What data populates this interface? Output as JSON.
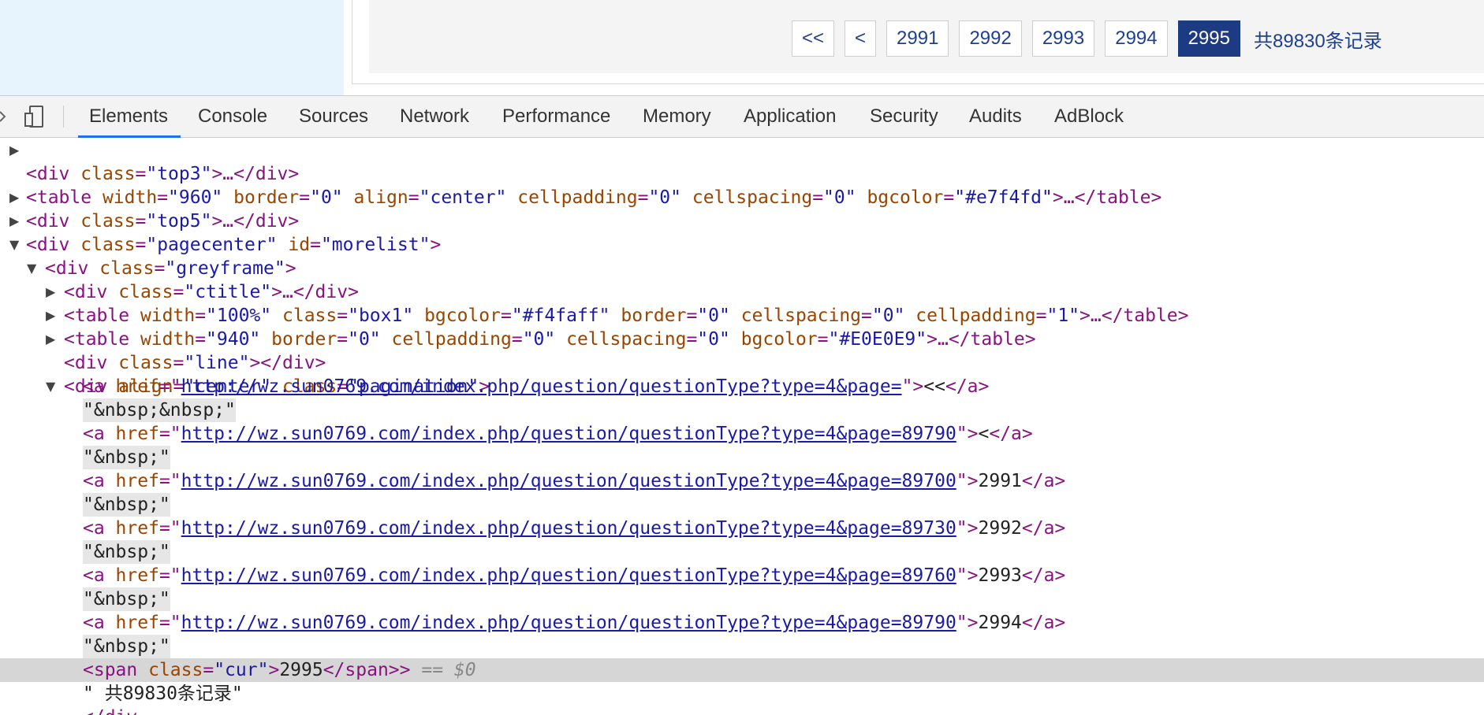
{
  "pagination": {
    "first": "<<",
    "prev": "<",
    "pages": [
      "2991",
      "2992",
      "2993",
      "2994"
    ],
    "current": "2995",
    "total_text": "共89830条记录"
  },
  "devtools": {
    "tabs": [
      "Elements",
      "Console",
      "Sources",
      "Network",
      "Performance",
      "Memory",
      "Application",
      "Security",
      "Audits",
      "AdBlock"
    ],
    "active_tab": "Elements",
    "dom": {
      "l1": {
        "open": "<div ",
        "a1": "class",
        "v1": "\"top3\"",
        "close": ">…</div>"
      },
      "l2": {
        "open": "<table ",
        "a1": "width",
        "v1": "\"960\"",
        "a2": "border",
        "v2": "\"0\"",
        "a3": "align",
        "v3": "\"center\"",
        "a4": "cellpadding",
        "v4": "\"0\"",
        "a5": "cellspacing",
        "v5": "\"0\"",
        "a6": "bgcolor",
        "v6": "\"#e7f4fd\"",
        "close": ">…</table>"
      },
      "l3": {
        "open": "<div ",
        "a1": "class",
        "v1": "\"top5\"",
        "close": ">…</div>"
      },
      "l4": {
        "open": "<div ",
        "a1": "class",
        "v1": "\"pagecenter\"",
        "a2": "id",
        "v2": "\"morelist\"",
        "close": ">"
      },
      "l5": {
        "open": "<div ",
        "a1": "class",
        "v1": "\"greyframe\"",
        "close": ">"
      },
      "l6": {
        "open": "<div ",
        "a1": "class",
        "v1": "\"ctitle\"",
        "close": ">…</div>"
      },
      "l7": {
        "open": "<table ",
        "a1": "width",
        "v1": "\"100%\"",
        "a2": "class",
        "v2": "\"box1\"",
        "a3": "bgcolor",
        "v3": "\"#f4faff\"",
        "a4": "border",
        "v4": "\"0\"",
        "a5": "cellspacing",
        "v5": "\"0\"",
        "a6": "cellpadding",
        "v6": "\"1\"",
        "close": ">…</table>"
      },
      "l8": {
        "open": "<table ",
        "a1": "width",
        "v1": "\"940\"",
        "a2": "border",
        "v2": "\"0\"",
        "a3": "cellpadding",
        "v3": "\"0\"",
        "a4": "cellspacing",
        "v4": "\"0\"",
        "a5": "bgcolor",
        "v5": "\"#E0E0E9\"",
        "close": ">…</table>"
      },
      "l9": {
        "open": "<div ",
        "a1": "class",
        "v1": "\"line\"",
        "close": "></div>"
      },
      "l10": {
        "open": "<div ",
        "a1": "align",
        "v1": "\"center\"",
        "a2": "class",
        "v2": "\"pagination\"",
        "close": ">"
      },
      "links": [
        {
          "url": "http://wz.sun0769.com/index.php/question/questionType?type=4&page=",
          "text": "<<",
          "after": "\"&nbsp;&nbsp;\""
        },
        {
          "url": "http://wz.sun0769.com/index.php/question/questionType?type=4&page=89790",
          "text": "<",
          "after": "\"&nbsp;\""
        },
        {
          "url": "http://wz.sun0769.com/index.php/question/questionType?type=4&page=89700",
          "text": "2991",
          "after": "\"&nbsp;\""
        },
        {
          "url": "http://wz.sun0769.com/index.php/question/questionType?type=4&page=89730",
          "text": "2992",
          "after": "\"&nbsp;\""
        },
        {
          "url": "http://wz.sun0769.com/index.php/question/questionType?type=4&page=89760",
          "text": "2993",
          "after": "\"&nbsp;\""
        },
        {
          "url": "http://wz.sun0769.com/index.php/question/questionType?type=4&page=89790",
          "text": "2994",
          "after": "\"&nbsp;\""
        }
      ],
      "span_line": {
        "open": "<span ",
        "a1": "class",
        "v1": "\"cur\"",
        "text": "2995",
        "close": "</span>",
        "marker": "== $0"
      },
      "text_line": "\" 共89830条记录\"",
      "partial": "</div"
    }
  }
}
